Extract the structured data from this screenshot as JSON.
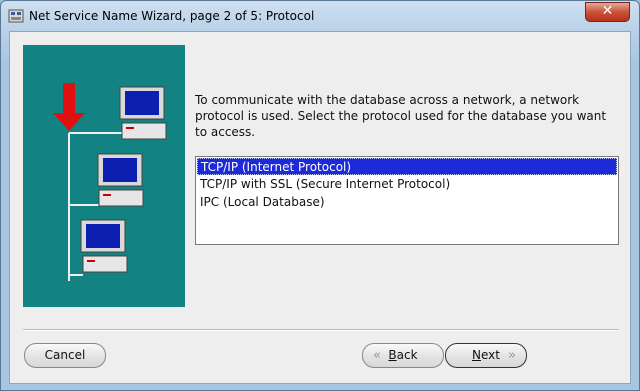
{
  "window": {
    "title": "Net Service Name Wizard, page 2 of 5: Protocol",
    "close_label": "✕"
  },
  "page": {
    "instruction": "To communicate with the database across a network, a network protocol is used.  Select the protocol used for the database you want to access.",
    "protocols": [
      {
        "label": "TCP/IP (Internet Protocol)",
        "selected": true
      },
      {
        "label": "TCP/IP with SSL (Secure Internet Protocol)",
        "selected": false
      },
      {
        "label": "IPC (Local Database)",
        "selected": false
      }
    ]
  },
  "buttons": {
    "cancel": "Cancel",
    "back_mnemonic": "B",
    "back_rest": "ack",
    "next_mnemonic": "N",
    "next_rest": "ext"
  },
  "colors": {
    "graphic_bg": "#128282",
    "selection": "#1d2ad8",
    "arrow": "#e01010"
  },
  "icons": {
    "app": "wizard-app-icon",
    "close": "close-icon",
    "back": "chevron-left-icon",
    "next": "chevron-right-icon"
  }
}
